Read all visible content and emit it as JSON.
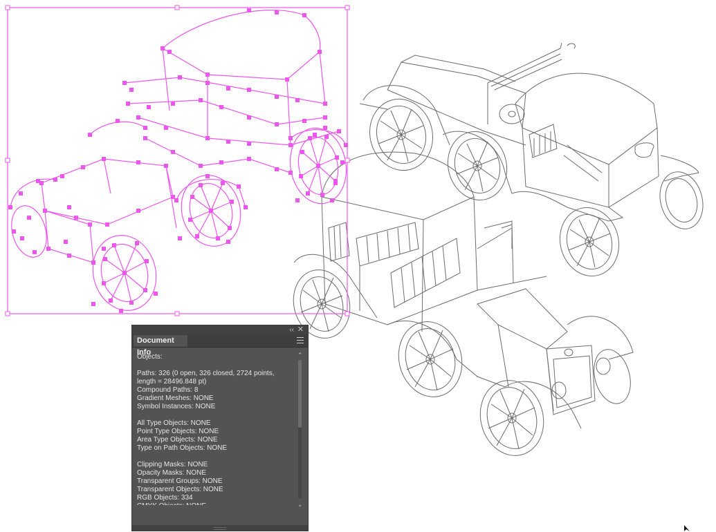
{
  "colors": {
    "selection": "#ee55ee",
    "linework": "#6b6b6b",
    "panel_bg": "#535353",
    "panel_text": "#e6e6e6"
  },
  "canvas": {
    "selected_object": "vintage-car-isometric-outline",
    "other_objects": [
      "vintage-car-back-view",
      "vintage-car-front-view"
    ]
  },
  "panel": {
    "tab_label": "Document Info",
    "collapse_glyph": "‹‹",
    "close_glyph": "✕",
    "menu_icon": "hamburger-icon",
    "lines": [
      "Objects:",
      "",
      "Paths: 326 (0 open, 326 closed, 2724 points,",
      "length = 28496.848 pt)",
      "Compound Paths: 8",
      "Gradient Meshes: NONE",
      "Symbol Instances: NONE",
      "",
      "All Type Objects: NONE",
      "Point Type Objects: NONE",
      "Area Type Objects: NONE",
      "Type on Path Objects: NONE",
      "",
      "Clipping Masks: NONE",
      "Opacity Masks: NONE",
      "Transparent Groups: NONE",
      "Transparent Objects: NONE",
      "RGB Objects: 334",
      "CMYK Objects: NONE"
    ]
  },
  "scrollbar": {
    "up_glyph": "⌃",
    "down_glyph": "⌄"
  }
}
